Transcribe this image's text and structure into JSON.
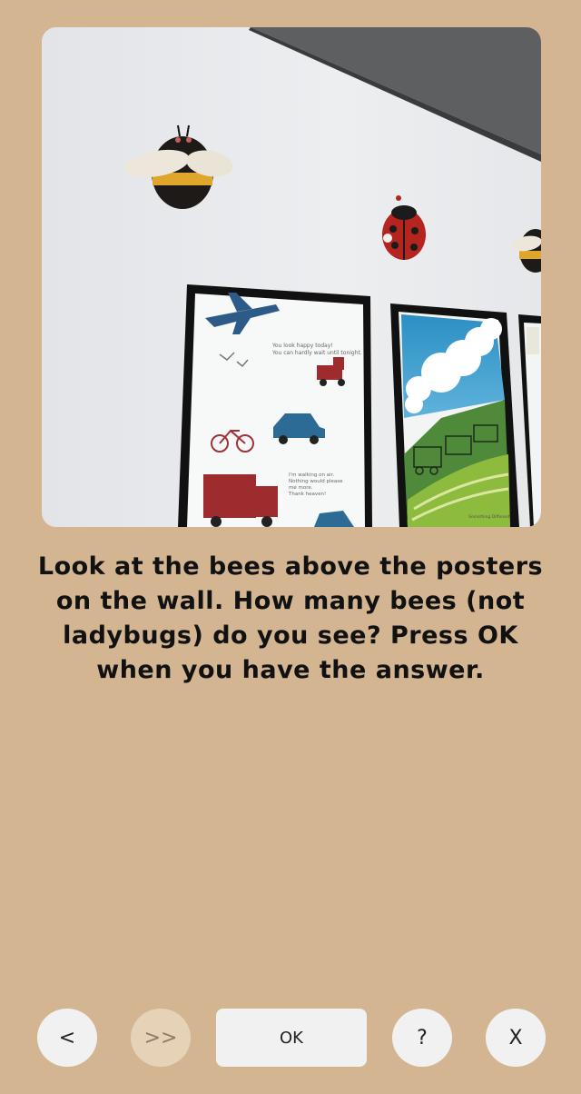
{
  "photo": {
    "poster1": {
      "text_top": [
        "You look happy today!",
        "You can hardly wait until tonight."
      ],
      "text_mid": [
        "I'm walking on air.",
        "Nothing would please",
        "me more.",
        "Thank heaven!"
      ]
    },
    "poster2": {
      "caption": "Something Different"
    }
  },
  "prompt": {
    "text": "Look at the bees above the posters on the wall. How many bees (not ladybugs) do you see? Press OK when you have the answer."
  },
  "controls": {
    "back_label": "<",
    "skip_label": ">>",
    "ok_label": "OK",
    "help_label": "?",
    "close_label": "X"
  },
  "colors": {
    "background": "#d3b592",
    "button": "#f2f1f2",
    "button_disabled": "#e6d2b6"
  }
}
